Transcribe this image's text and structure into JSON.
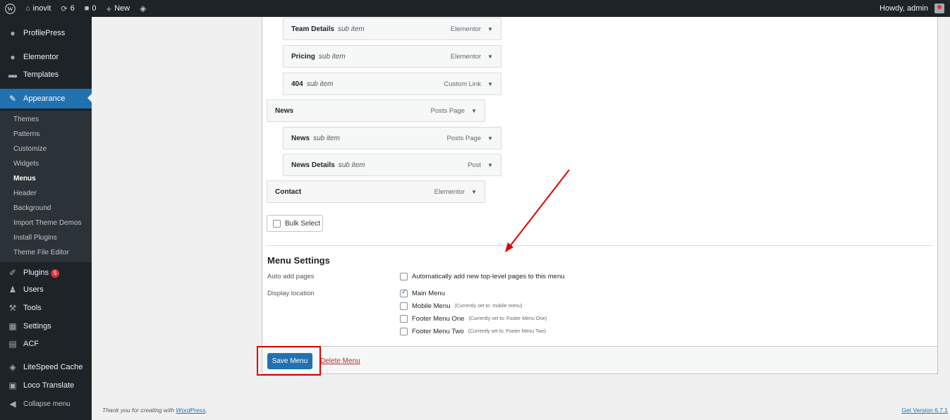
{
  "adminbar": {
    "site_name": "inovit",
    "updates_count": "6",
    "comments_count": "0",
    "new_label": "New",
    "howdy": "Howdy, admin"
  },
  "sidebar": {
    "items": [
      {
        "label": "ProfilePress",
        "icon": "profilepress-icon"
      },
      {
        "label": "Elementor",
        "icon": "elementor-icon"
      },
      {
        "label": "Templates",
        "icon": "folder-icon"
      },
      {
        "label": "Appearance",
        "icon": "paintbrush-icon"
      },
      {
        "label": "Plugins",
        "icon": "plug-icon",
        "badge": "5"
      },
      {
        "label": "Users",
        "icon": "users-icon"
      },
      {
        "label": "Tools",
        "icon": "wrench-icon"
      },
      {
        "label": "Settings",
        "icon": "settings-icon"
      },
      {
        "label": "ACF",
        "icon": "acf-icon"
      },
      {
        "label": "LiteSpeed Cache",
        "icon": "litespeed-icon"
      },
      {
        "label": "Loco Translate",
        "icon": "translate-icon"
      },
      {
        "label": "Collapse menu",
        "icon": "collapse-icon"
      }
    ],
    "submenu": [
      "Themes",
      "Patterns",
      "Customize",
      "Widgets",
      "Menus",
      "Header",
      "Background",
      "Import Theme Demos",
      "Install Plugins",
      "Theme File Editor"
    ]
  },
  "menu_items": [
    {
      "title": "Team Details",
      "sub": "sub item",
      "type": "Elementor"
    },
    {
      "title": "Pricing",
      "sub": "sub item",
      "type": "Elementor"
    },
    {
      "title": "404",
      "sub": "sub item",
      "type": "Custom Link"
    },
    {
      "title": "News",
      "sub": "",
      "type": "Posts Page"
    },
    {
      "title": "News",
      "sub": "sub item",
      "type": "Posts Page"
    },
    {
      "title": "News Details",
      "sub": "sub item",
      "type": "Post"
    },
    {
      "title": "Contact",
      "sub": "",
      "type": "Elementor"
    }
  ],
  "bulk_select_label": "Bulk Select",
  "menu_settings": {
    "heading": "Menu Settings",
    "auto_add_label": "Auto add pages",
    "auto_add_option": "Automatically add new top-level pages to this menu",
    "display_location_label": "Display location",
    "locations": [
      {
        "label": "Main Menu",
        "note": "",
        "checked": true
      },
      {
        "label": "Mobile Menu",
        "note": "(Currently set to: mobile menu)",
        "checked": false
      },
      {
        "label": "Footer Menu One",
        "note": "(Currently set to: Footer Menu One)",
        "checked": false
      },
      {
        "label": "Footer Menu Two",
        "note": "(Currently set to: Footer Menu Two)",
        "checked": false
      }
    ]
  },
  "actions": {
    "save_label": "Save Menu",
    "delete_label": "Delete Menu"
  },
  "footer": {
    "thanks_prefix": "Thank you for creating with ",
    "thanks_link": "WordPress",
    "thanks_suffix": ".",
    "version": "Get Version 6.7.1"
  },
  "colors": {
    "accent": "#2271b1",
    "admin_dark": "#1d2327",
    "highlight_red": "#e10000"
  }
}
